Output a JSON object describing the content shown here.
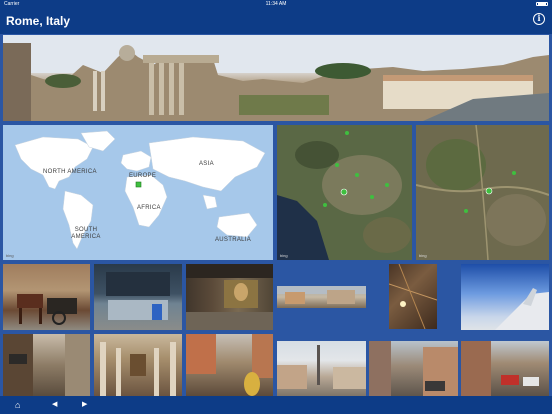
{
  "status_bar": {
    "carrier": "Carrier",
    "time": "11:34 AM"
  },
  "nav": {
    "title": "Rome, Italy",
    "info_icon": "info-icon",
    "info_glyph": "i"
  },
  "world_map": {
    "labels": [
      "NORTH AMERICA",
      "EUROPE",
      "ASIA",
      "AFRICA",
      "SOUTH AMERICA",
      "AUSTRALIA"
    ],
    "attribution": "bing"
  },
  "satellite_maps": {
    "attribution": "bing"
  },
  "toolbar": {
    "home_icon": "home-icon",
    "home_glyph": "⌂",
    "back_icon": "back-arrow-icon",
    "back_glyph": "◀",
    "forward_icon": "forward-arrow-icon",
    "forward_glyph": "▶"
  },
  "colors": {
    "bar": "#0d3c87",
    "background": "#2b56a3",
    "ocean": "#a6c8ea",
    "land": "#ffffff",
    "marker": "#3fbf3f"
  }
}
